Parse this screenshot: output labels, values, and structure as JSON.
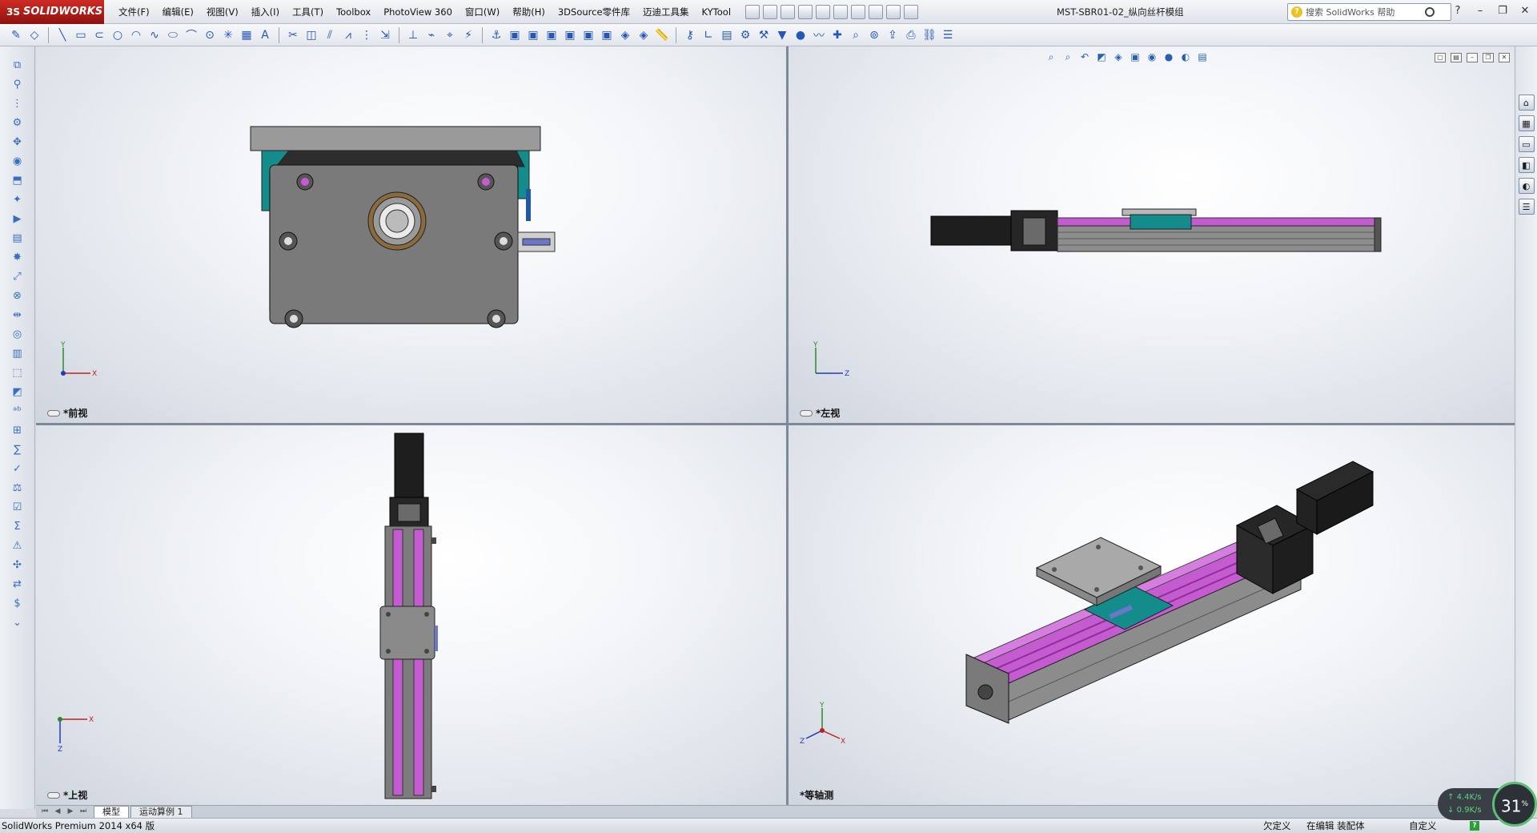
{
  "app": {
    "logo_text": "SOLIDWORKS",
    "logo_prefix": "3S",
    "document_title": "MST-SBR01-02_纵向丝杆模组"
  },
  "menu": [
    "文件(F)",
    "编辑(E)",
    "视图(V)",
    "插入(I)",
    "工具(T)",
    "Toolbox",
    "PhotoView 360",
    "窗口(W)",
    "帮助(H)",
    "3DSource零件库",
    "迈迪工具集",
    "KYTool"
  ],
  "help_search": {
    "placeholder": "搜索 SolidWorks 帮助"
  },
  "viewports": {
    "front": {
      "label": "*前视",
      "triad": [
        "Y",
        "X"
      ]
    },
    "left": {
      "label": "*左视",
      "triad": [
        "Y",
        "Z"
      ]
    },
    "top": {
      "label": "*上视",
      "triad": [
        "X",
        "Z"
      ]
    },
    "iso": {
      "label": "*等轴测",
      "triad": [
        "Y",
        "X",
        "Z"
      ]
    }
  },
  "tabs": {
    "model": "模型",
    "motion": "运动算例 1"
  },
  "status": {
    "product": "SolidWorks Premium 2014 x64 版",
    "under_defined": "欠定义",
    "editing": "在编辑 装配体",
    "custom": "自定义",
    "help_icon": "?"
  },
  "network": {
    "up": "4.4K/s",
    "down": "0.9K/s",
    "percent": "31",
    "percent_unit": "%"
  },
  "colors": {
    "rail": "#c55bd0",
    "teal": "#148c8c",
    "motor": "#1e1e1e",
    "plate": "#8a8a8a"
  }
}
